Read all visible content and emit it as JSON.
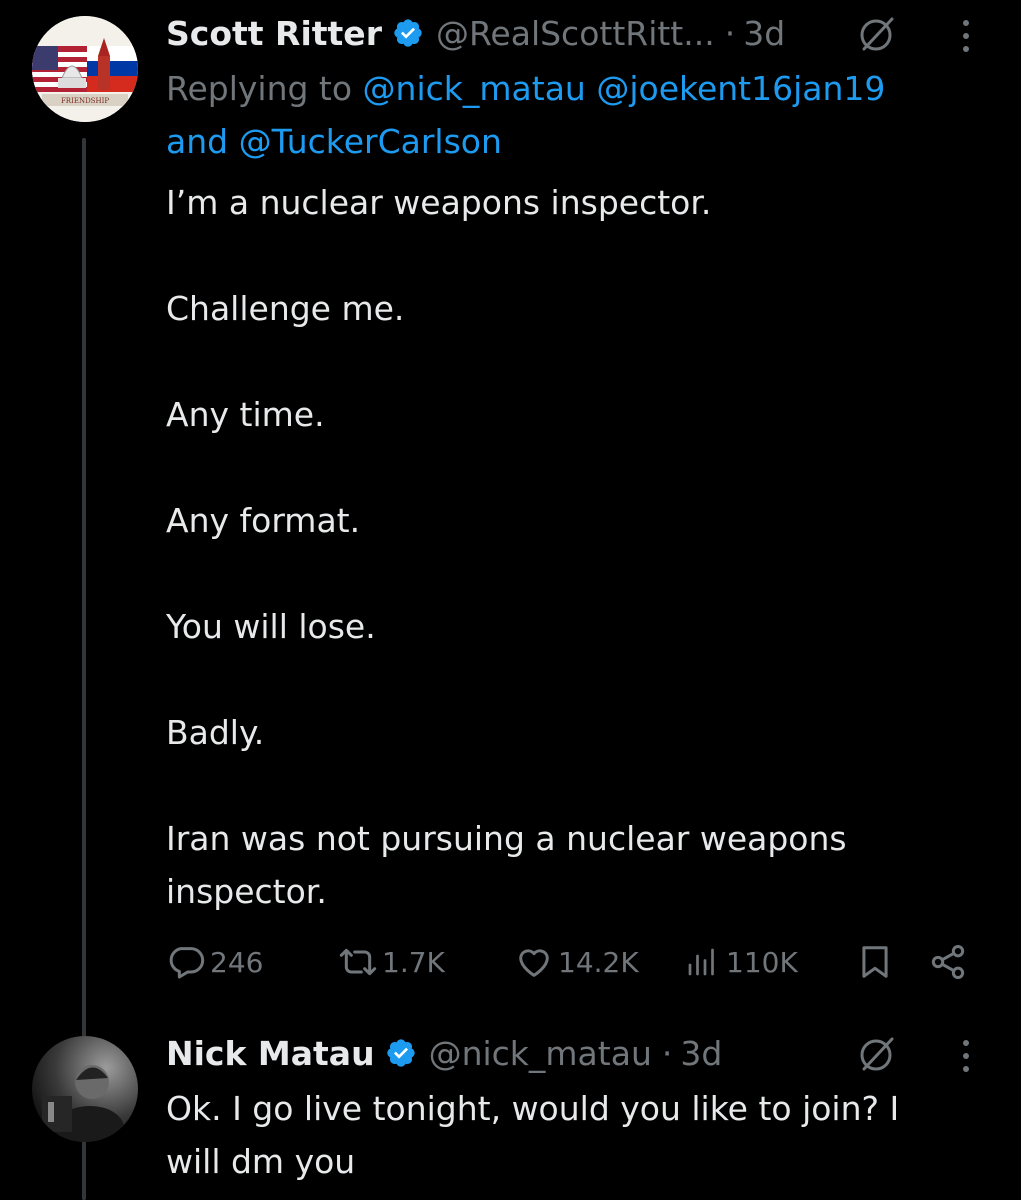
{
  "tweet1": {
    "display_name": "Scott Ritter",
    "handle": "@RealScottRitt...",
    "separator": "·",
    "time": "3d",
    "replying_prefix": "Replying to",
    "mention1": "@nick_matau",
    "mention2": "@joekent16jan19",
    "mention_and": "and",
    "mention3": "@TuckerCarlson",
    "body": "I’m a nuclear weapons inspector.\n\nChallenge me.\n\nAny time.\n\nAny format.\n\nYou will lose.\n\nBadly.\n\nIran was not pursuing a nuclear weapons\ninspector.",
    "replies": "246",
    "reposts": "1.7K",
    "likes": "14.2K",
    "views": "110K"
  },
  "tweet2": {
    "display_name": "Nick Matau",
    "handle": "@nick_matau",
    "separator": "·",
    "time": "3d",
    "body": "Ok. I go live tonight, would you like to join? I\nwill dm you"
  },
  "colors": {
    "background": "#000000",
    "text": "#e7e9ea",
    "muted": "#71767b",
    "link": "#1d9bf0",
    "verified": "#1d9bf0"
  },
  "icons": [
    "verified-badge-icon",
    "grok-icon",
    "more-options-icon",
    "reply-icon",
    "repost-icon",
    "like-icon",
    "views-icon",
    "bookmark-icon",
    "share-icon"
  ]
}
